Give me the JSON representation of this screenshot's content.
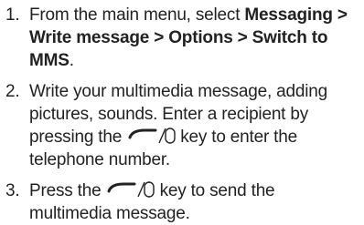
{
  "steps": [
    {
      "number": "1.",
      "text_before": "From the main menu, select ",
      "bold_path": "Messaging > Write message > Options > Switch to MMS",
      "text_after": "."
    },
    {
      "number": "2.",
      "text_before": "Write your multimedia message, adding pictures, sounds. Enter a recipient by pressing the",
      "key_icon": "call-key-icon",
      "text_after": "key to enter the telephone number."
    },
    {
      "number": "3.",
      "text_before": "Press the",
      "key_icon": "call-key-icon",
      "text_after": "key to send the multimedia message."
    }
  ]
}
